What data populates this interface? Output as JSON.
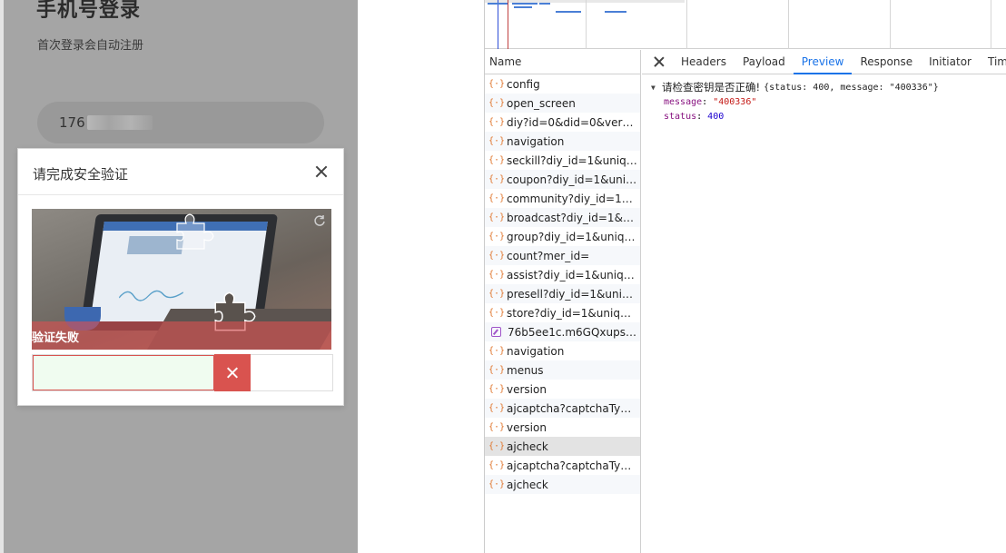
{
  "login": {
    "title": "手机号登录",
    "subtitle": "首次登录会自动注册",
    "phone_prefix": "176"
  },
  "captcha": {
    "title": "请完成安全验证",
    "fail_text": "验证失败",
    "colors": {
      "fail": "#d9534f",
      "track": "#f0fcf0"
    }
  },
  "devtools": {
    "name_header": "Name",
    "tabs": [
      "Headers",
      "Payload",
      "Preview",
      "Response",
      "Initiator",
      "Tim"
    ],
    "active_tab": "Preview",
    "requests": [
      {
        "name": "config",
        "type": "xhr"
      },
      {
        "name": "open_screen",
        "type": "xhr"
      },
      {
        "name": "diy?id=0&did=0&versi...",
        "type": "xhr"
      },
      {
        "name": "navigation",
        "type": "xhr"
      },
      {
        "name": "seckill?diy_id=1&uniqu...",
        "type": "xhr"
      },
      {
        "name": "coupon?diy_id=1&uniq...",
        "type": "xhr"
      },
      {
        "name": "community?diy_id=1&...",
        "type": "xhr"
      },
      {
        "name": "broadcast?diy_id=1&u...",
        "type": "xhr"
      },
      {
        "name": "group?diy_id=1&uniqu...",
        "type": "xhr"
      },
      {
        "name": "count?mer_id=",
        "type": "xhr"
      },
      {
        "name": "assist?diy_id=1&uniqu...",
        "type": "xhr"
      },
      {
        "name": "presell?diy_id=1&uniq...",
        "type": "xhr"
      },
      {
        "name": "store?diy_id=1&unique...",
        "type": "xhr"
      },
      {
        "name": "76b5ee1c.m6GQxups.css",
        "type": "css"
      },
      {
        "name": "navigation",
        "type": "xhr"
      },
      {
        "name": "menus",
        "type": "xhr"
      },
      {
        "name": "version",
        "type": "xhr"
      },
      {
        "name": "ajcaptcha?captchaType...",
        "type": "xhr"
      },
      {
        "name": "version",
        "type": "xhr"
      },
      {
        "name": "ajcheck",
        "type": "xhr",
        "selected": true
      },
      {
        "name": "ajcaptcha?captchaType...",
        "type": "xhr"
      },
      {
        "name": "ajcheck",
        "type": "xhr"
      }
    ],
    "preview": {
      "message_text": "请检查密钥是否正确!",
      "summary": "{status: 400, message: \"400336\"}",
      "message_key": "message",
      "message_value": "\"400336\"",
      "status_key": "status",
      "status_value": "400"
    }
  }
}
